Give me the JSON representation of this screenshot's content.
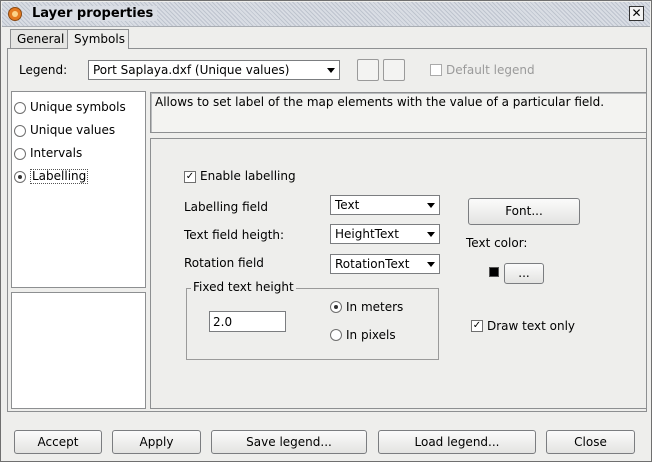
{
  "window": {
    "title": "Layer properties",
    "close_glyph": "✕"
  },
  "tabs": [
    {
      "label": "General",
      "active": false
    },
    {
      "label": "Symbols",
      "active": true
    }
  ],
  "legend_row": {
    "label": "Legend:",
    "selected": "Port Saplaya.dxf (Unique values)",
    "default_legend_label": "Default legend",
    "default_legend_checked": false
  },
  "legend_types": [
    {
      "label": "Unique symbols",
      "selected": false
    },
    {
      "label": "Unique values",
      "selected": false
    },
    {
      "label": "Intervals",
      "selected": false
    },
    {
      "label": "Labelling",
      "selected": true
    }
  ],
  "description": "Allows to set label of the map elements with the value of a particular field.",
  "labelling": {
    "enable_label": "Enable labelling",
    "enable_checked": true,
    "labelling_field_label": "Labelling field",
    "labelling_field_value": "Text",
    "height_field_label": "Text field heigth:",
    "height_field_value": "HeightText",
    "rotation_field_label": "Rotation field",
    "rotation_field_value": "RotationText",
    "font_button": "Font...",
    "text_color_label": "Text color:",
    "text_color": "#000000",
    "color_button": "...",
    "fixed_height_title": "Fixed text height",
    "fixed_height_value": "2.0",
    "in_meters_label": "In meters",
    "in_meters_selected": true,
    "in_pixels_label": "In pixels",
    "in_pixels_selected": false,
    "draw_text_only_label": "Draw text only",
    "draw_text_only_checked": true
  },
  "buttons": {
    "accept": "Accept",
    "apply": "Apply",
    "save_legend": "Save legend...",
    "load_legend": "Load legend...",
    "close": "Close"
  },
  "colors": {
    "window_bg": "#eeeeec",
    "title_bg": "#d9dde4",
    "border": "#8d8f91",
    "app_icon": "#e47a21"
  },
  "icons": {
    "app": "gvsig-app-icon",
    "close": "close-icon",
    "dropdown": "chevron-down-icon"
  }
}
